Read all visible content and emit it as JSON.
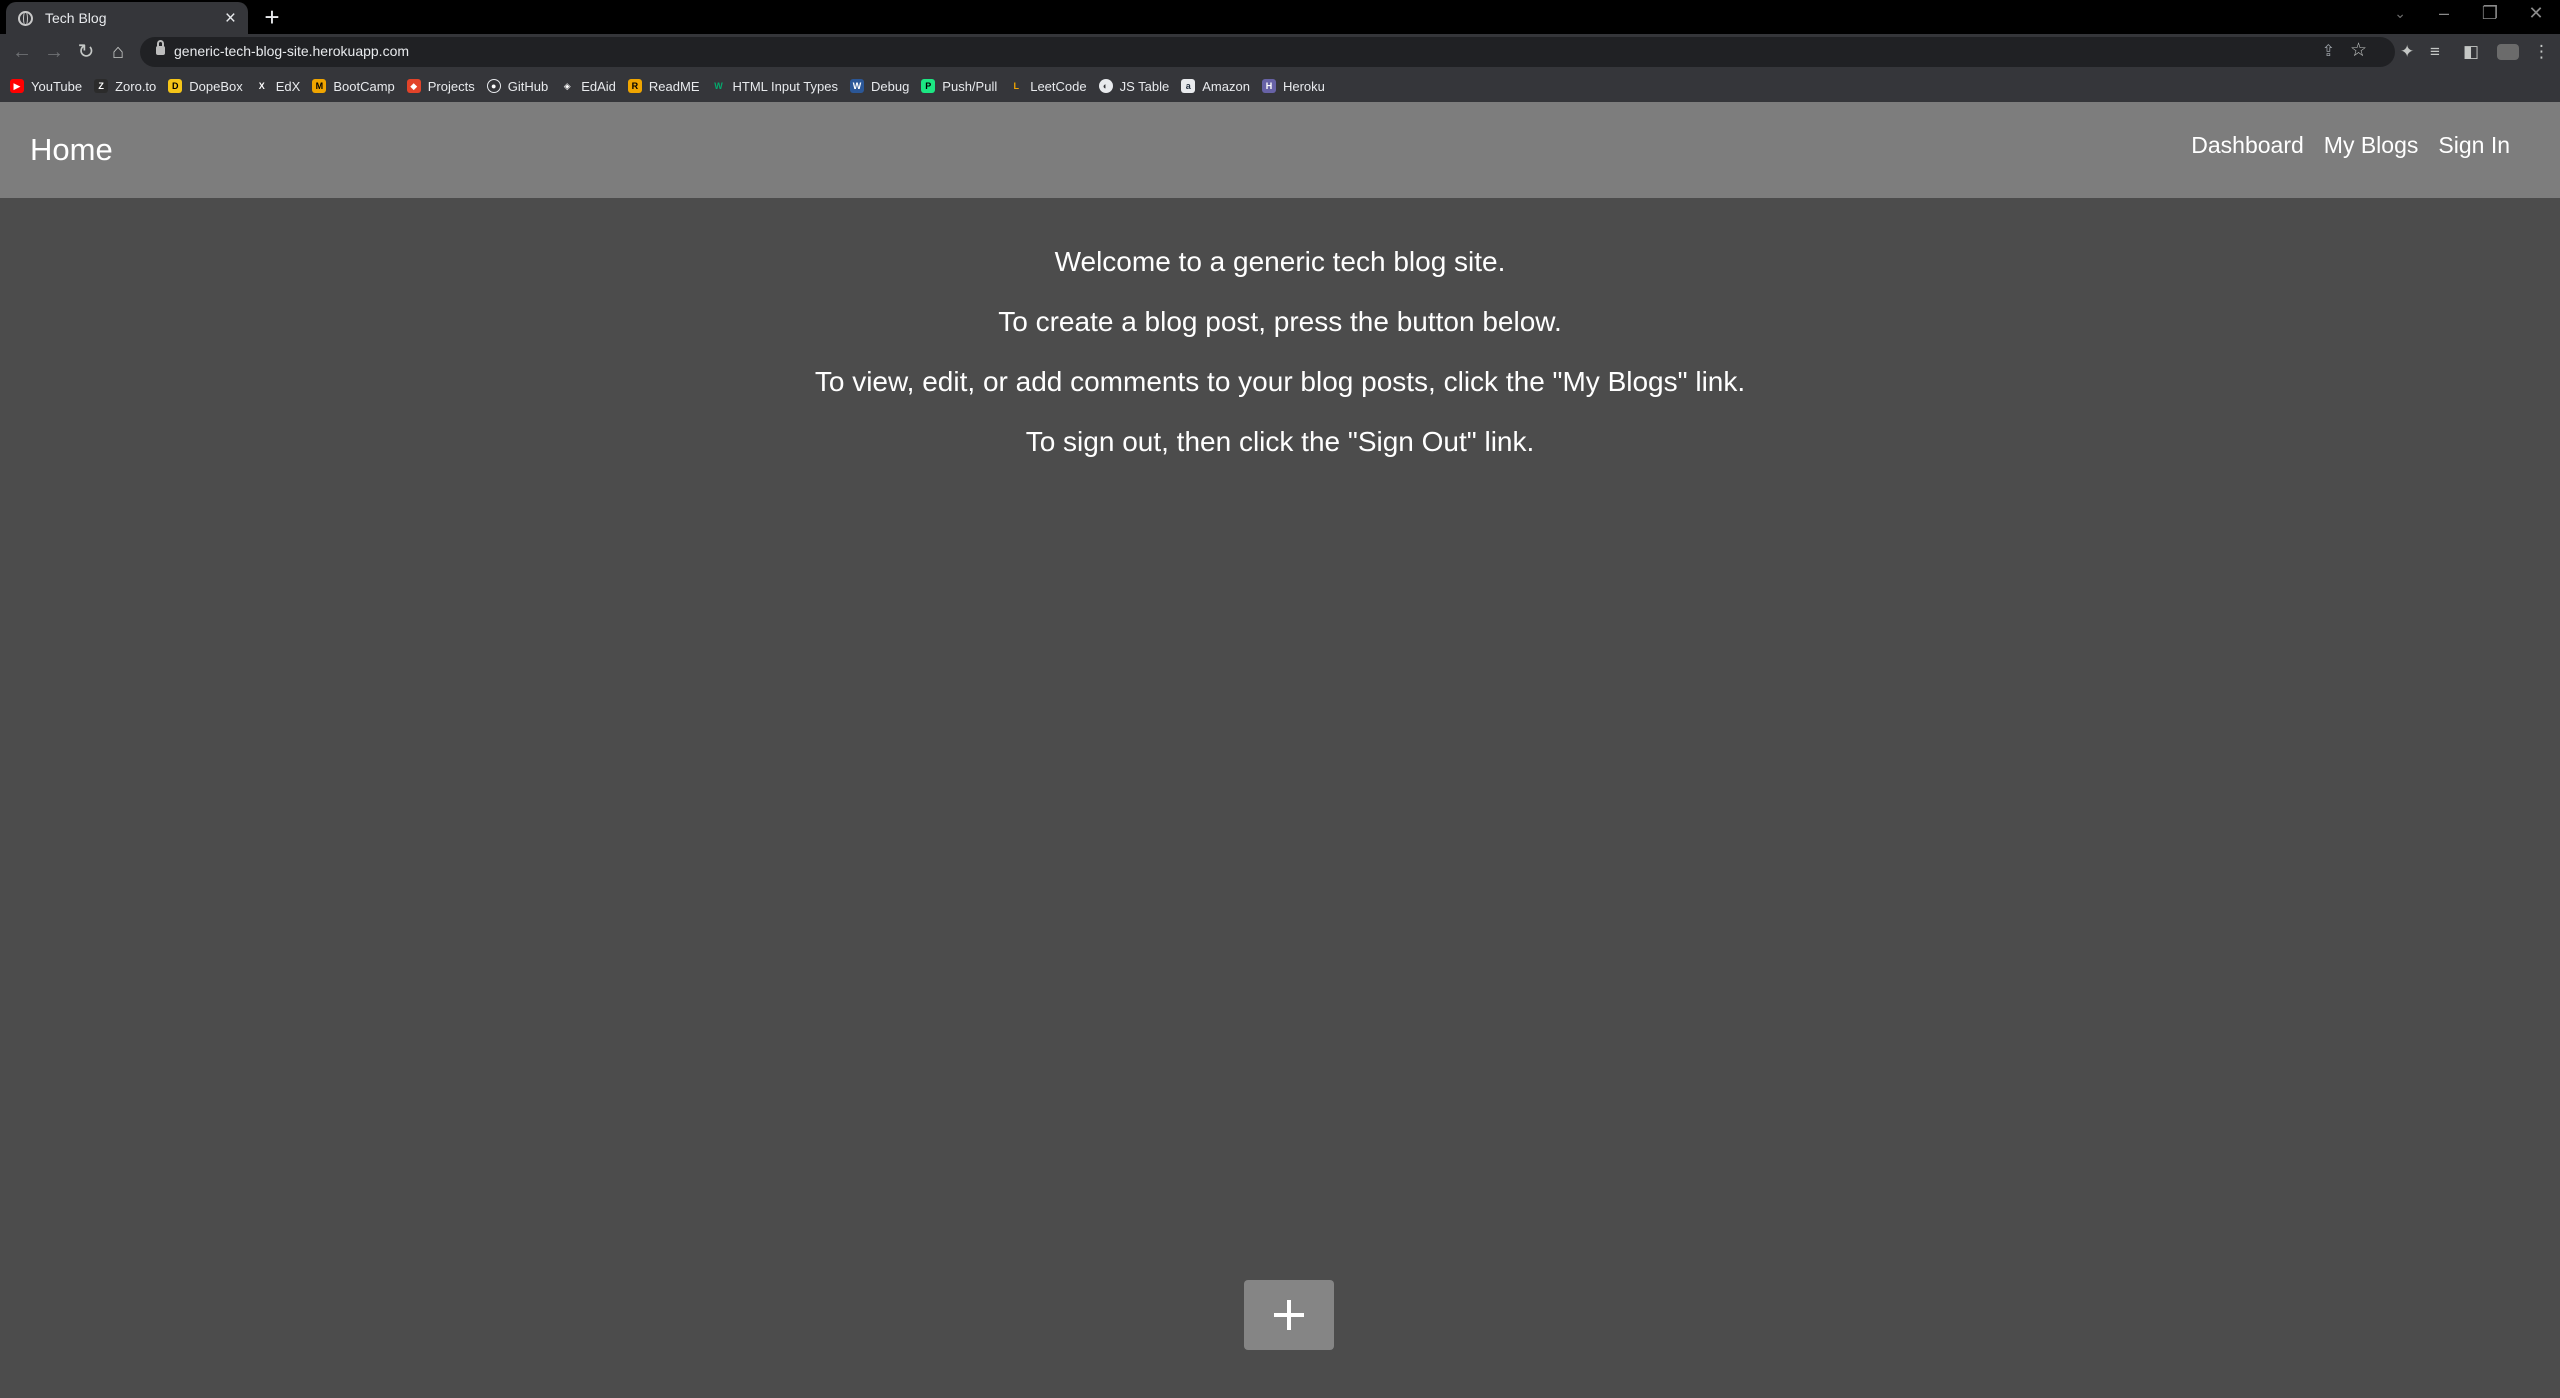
{
  "browser": {
    "tab_title": "Tech Blog",
    "url": "generic-tech-blog-site.herokuapp.com",
    "bookmarks": [
      {
        "label": "YouTube",
        "color": "#ff0000"
      },
      {
        "label": "Zoro.to",
        "color": "#2b2b2b"
      },
      {
        "label": "DopeBox",
        "color": "#f5c518"
      },
      {
        "label": "EdX",
        "color": "#35363a"
      },
      {
        "label": "BootCamp",
        "color": "#f0a500"
      },
      {
        "label": "Projects",
        "color": "#e24329"
      },
      {
        "label": "GitHub",
        "color": "#35363a"
      },
      {
        "label": "EdAid",
        "color": "#35363a"
      },
      {
        "label": "ReadME",
        "color": "#f0a500"
      },
      {
        "label": "HTML Input Types",
        "color": "#04aa6d"
      },
      {
        "label": "Debug",
        "color": "#2b5797"
      },
      {
        "label": "Push/Pull",
        "color": "#1ce783"
      },
      {
        "label": "LeetCode",
        "color": "#35363a"
      },
      {
        "label": "JS Table",
        "color": "#35363a"
      },
      {
        "label": "Amazon",
        "color": "#232f3e"
      },
      {
        "label": "Heroku",
        "color": "#6762a6"
      }
    ]
  },
  "nav": {
    "brand": "Home",
    "links": [
      "Dashboard",
      "My Blogs",
      "Sign In"
    ]
  },
  "welcome": {
    "line1": "Welcome to a generic tech blog site.",
    "line2": "To create a blog post, press the button below.",
    "line3": "To view, edit, or add comments to your blog posts, click the \"My Blogs\" link.",
    "line4": "To sign out, then click the \"Sign Out\" link."
  },
  "colors": {
    "page_bg": "#4c4c4c",
    "navbar_bg": "#7d7d7d",
    "button_bg": "#858585"
  }
}
